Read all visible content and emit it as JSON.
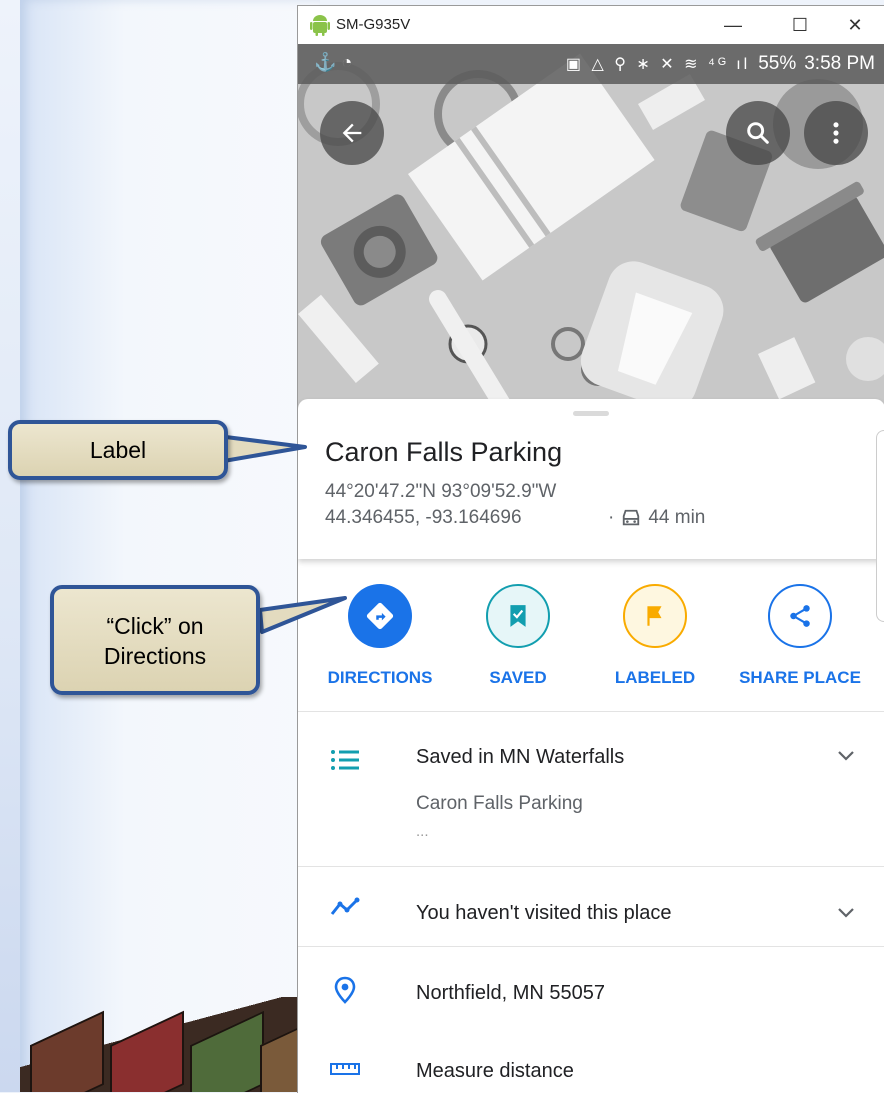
{
  "window": {
    "title": "SM-G935V",
    "minimize": "—",
    "maximize": "☐",
    "close": "✕"
  },
  "statusbar": {
    "left_icons": "⚓ ◔",
    "right_icons": "▣ △ ⚲ ∗ ✕ ≋ ⁴ᴳ ıl",
    "battery": "55%",
    "time": "3:58 PM"
  },
  "place": {
    "name": "Caron Falls Parking",
    "coords_dms": "44°20'47.2\"N 93°09'52.9\"W",
    "coords_decimal": "44.346455, -93.164696",
    "drive_time": "44 min",
    "drive_sep": "·"
  },
  "actions": [
    {
      "label": "DIRECTIONS",
      "color": "#1a73e8"
    },
    {
      "label": "SAVED",
      "color": "#129eaf"
    },
    {
      "label": "LABELED",
      "color": "#f9ab00"
    },
    {
      "label": "SHARE PLACE",
      "color": "#1a73e8"
    }
  ],
  "rows": {
    "saved": {
      "title": "Saved in MN Waterfalls",
      "subtitle": "Caron Falls Parking",
      "more": "..."
    },
    "visited": "You haven't visited this place",
    "address": "Northfield, MN 55057",
    "measure": "Measure distance"
  },
  "callouts": {
    "label": "Label",
    "click_line1": "“Click” on",
    "click_line2": "Directions"
  },
  "colors": {
    "accent": "#1a73e8",
    "callout_border": "#2f5597",
    "callout_fill": "#e3dbbf"
  }
}
